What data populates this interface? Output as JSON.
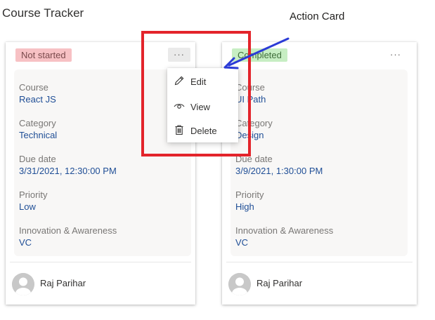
{
  "page": {
    "title": "Course Tracker"
  },
  "annotation": {
    "label": "Action Card"
  },
  "cards": [
    {
      "status": "Not started",
      "status_bg": "#f7c1c4",
      "status_color": "#7a4a4c",
      "more_label": "···",
      "fields": [
        {
          "label": "Course",
          "value": "React JS"
        },
        {
          "label": "Category",
          "value": "Technical"
        },
        {
          "label": "Due date",
          "value": "3/31/2021, 12:30:00 PM"
        },
        {
          "label": "Priority",
          "value": "Low"
        },
        {
          "label": "Innovation & Awareness",
          "value": "VC"
        }
      ],
      "user": "Raj Parihar"
    },
    {
      "status": "Completed",
      "status_bg": "#c7eec3",
      "status_color": "#3f6e3a",
      "more_label": "···",
      "fields": [
        {
          "label": "Course",
          "value": "UI Path"
        },
        {
          "label": "Category",
          "value": "Design"
        },
        {
          "label": "Due date",
          "value": "3/9/2021, 1:30:00 PM"
        },
        {
          "label": "Priority",
          "value": "High"
        },
        {
          "label": "Innovation & Awareness",
          "value": "VC"
        }
      ],
      "user": "Raj Parihar"
    }
  ],
  "menu": {
    "items": [
      {
        "label": "Edit",
        "icon": "pencil-icon"
      },
      {
        "label": "View",
        "icon": "eye-icon"
      },
      {
        "label": "Delete",
        "icon": "trash-icon"
      }
    ]
  },
  "colors": {
    "highlight": "#e3242b",
    "arrow": "#2b3bd6",
    "value_text": "#1f4e96"
  }
}
